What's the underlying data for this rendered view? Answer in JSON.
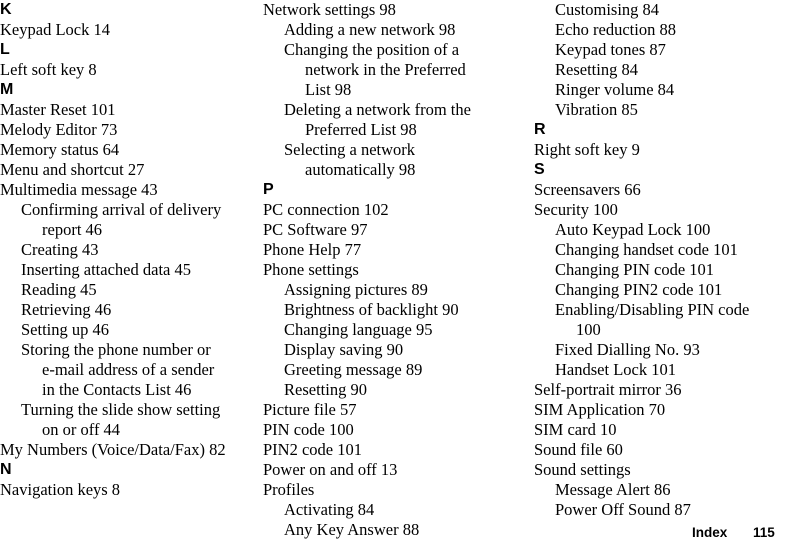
{
  "document": {
    "type": "printed-index-page",
    "footer": {
      "section_label": "Index",
      "page_number": "115"
    }
  },
  "columns": [
    {
      "id": "column-1",
      "blocks": [
        {
          "kind": "heading",
          "text": "K"
        },
        {
          "kind": "entry",
          "level": 0,
          "text": "Keypad Lock 14"
        },
        {
          "kind": "heading",
          "text": "L"
        },
        {
          "kind": "entry",
          "level": 0,
          "text": "Left soft key 8"
        },
        {
          "kind": "heading",
          "text": "M"
        },
        {
          "kind": "entry",
          "level": 0,
          "text": "Master Reset 101"
        },
        {
          "kind": "entry",
          "level": 0,
          "text": "Melody Editor 73"
        },
        {
          "kind": "entry",
          "level": 0,
          "text": "Memory status 64"
        },
        {
          "kind": "entry",
          "level": 0,
          "text": "Menu and shortcut 27"
        },
        {
          "kind": "entry",
          "level": 0,
          "text": "Multimedia message 43"
        },
        {
          "kind": "entry",
          "level": 1,
          "text": "Confirming arrival of delivery"
        },
        {
          "kind": "entry",
          "level": 2,
          "text": "report 46"
        },
        {
          "kind": "entry",
          "level": 1,
          "text": "Creating 43"
        },
        {
          "kind": "entry",
          "level": 1,
          "text": "Inserting attached data 45"
        },
        {
          "kind": "entry",
          "level": 1,
          "text": "Reading 45"
        },
        {
          "kind": "entry",
          "level": 1,
          "text": "Retrieving 46"
        },
        {
          "kind": "entry",
          "level": 1,
          "text": "Setting up 46"
        },
        {
          "kind": "entry",
          "level": 1,
          "text": "Storing the phone number or"
        },
        {
          "kind": "entry",
          "level": 2,
          "text": "e-mail address of a sender"
        },
        {
          "kind": "entry",
          "level": 2,
          "text": "in the Contacts List 46"
        },
        {
          "kind": "entry",
          "level": 1,
          "text": "Turning the slide show setting"
        },
        {
          "kind": "entry",
          "level": 2,
          "text": "on or off 44"
        },
        {
          "kind": "entry",
          "level": 0,
          "text": "My Numbers (Voice/Data/Fax) 82"
        },
        {
          "kind": "heading",
          "text": "N"
        },
        {
          "kind": "entry",
          "level": 0,
          "text": "Navigation keys 8"
        }
      ]
    },
    {
      "id": "column-2",
      "blocks": [
        {
          "kind": "entry",
          "level": 0,
          "text": "Network settings 98"
        },
        {
          "kind": "entry",
          "level": 1,
          "text": "Adding a new network 98"
        },
        {
          "kind": "entry",
          "level": 1,
          "text": "Changing the position of a"
        },
        {
          "kind": "entry",
          "level": 2,
          "text": "network in the Preferred"
        },
        {
          "kind": "entry",
          "level": 2,
          "text": "List 98"
        },
        {
          "kind": "entry",
          "level": 1,
          "text": "Deleting a network from the"
        },
        {
          "kind": "entry",
          "level": 2,
          "text": "Preferred List 98"
        },
        {
          "kind": "entry",
          "level": 1,
          "text": "Selecting a network"
        },
        {
          "kind": "entry",
          "level": 2,
          "text": "automatically 98"
        },
        {
          "kind": "heading",
          "text": "P"
        },
        {
          "kind": "entry",
          "level": 0,
          "text": "PC connection 102"
        },
        {
          "kind": "entry",
          "level": 0,
          "text": "PC Software 97"
        },
        {
          "kind": "entry",
          "level": 0,
          "text": "Phone Help 77"
        },
        {
          "kind": "entry",
          "level": 0,
          "text": "Phone settings"
        },
        {
          "kind": "entry",
          "level": 1,
          "text": "Assigning pictures 89"
        },
        {
          "kind": "entry",
          "level": 1,
          "text": "Brightness of backlight 90"
        },
        {
          "kind": "entry",
          "level": 1,
          "text": "Changing language 95"
        },
        {
          "kind": "entry",
          "level": 1,
          "text": "Display saving 90"
        },
        {
          "kind": "entry",
          "level": 1,
          "text": "Greeting message 89"
        },
        {
          "kind": "entry",
          "level": 1,
          "text": "Resetting 90"
        },
        {
          "kind": "entry",
          "level": 0,
          "text": "Picture file 57"
        },
        {
          "kind": "entry",
          "level": 0,
          "text": "PIN code 100"
        },
        {
          "kind": "entry",
          "level": 0,
          "text": "PIN2 code 101"
        },
        {
          "kind": "entry",
          "level": 0,
          "text": "Power on and off 13"
        },
        {
          "kind": "entry",
          "level": 0,
          "text": "Profiles"
        },
        {
          "kind": "entry",
          "level": 1,
          "text": "Activating 84"
        },
        {
          "kind": "entry",
          "level": 1,
          "text": "Any Key Answer 88"
        }
      ]
    },
    {
      "id": "column-3",
      "blocks": [
        {
          "kind": "entry",
          "level": 1,
          "text": "Customising 84"
        },
        {
          "kind": "entry",
          "level": 1,
          "text": "Echo reduction 88"
        },
        {
          "kind": "entry",
          "level": 1,
          "text": "Keypad tones 87"
        },
        {
          "kind": "entry",
          "level": 1,
          "text": "Resetting 84"
        },
        {
          "kind": "entry",
          "level": 1,
          "text": "Ringer volume 84"
        },
        {
          "kind": "entry",
          "level": 1,
          "text": "Vibration 85"
        },
        {
          "kind": "heading",
          "text": "R"
        },
        {
          "kind": "entry",
          "level": 0,
          "text": "Right soft key 9"
        },
        {
          "kind": "heading",
          "text": "S"
        },
        {
          "kind": "entry",
          "level": 0,
          "text": "Screensavers 66"
        },
        {
          "kind": "entry",
          "level": 0,
          "text": "Security 100"
        },
        {
          "kind": "entry",
          "level": 1,
          "text": "Auto Keypad Lock 100"
        },
        {
          "kind": "entry",
          "level": 1,
          "text": "Changing handset code 101"
        },
        {
          "kind": "entry",
          "level": 1,
          "text": "Changing PIN code 101"
        },
        {
          "kind": "entry",
          "level": 1,
          "text": "Changing PIN2 code 101"
        },
        {
          "kind": "entry",
          "level": 1,
          "text": "Enabling/Disabling PIN code"
        },
        {
          "kind": "entry",
          "level": 2,
          "text": "100"
        },
        {
          "kind": "entry",
          "level": 1,
          "text": "Fixed Dialling No. 93"
        },
        {
          "kind": "entry",
          "level": 1,
          "text": "Handset Lock 101"
        },
        {
          "kind": "entry",
          "level": 0,
          "text": "Self-portrait mirror 36"
        },
        {
          "kind": "entry",
          "level": 0,
          "text": "SIM Application 70"
        },
        {
          "kind": "entry",
          "level": 0,
          "text": "SIM card 10"
        },
        {
          "kind": "entry",
          "level": 0,
          "text": "Sound file 60"
        },
        {
          "kind": "entry",
          "level": 0,
          "text": "Sound settings"
        },
        {
          "kind": "entry",
          "level": 1,
          "text": "Message Alert 86"
        },
        {
          "kind": "entry",
          "level": 1,
          "text": "Power Off Sound 87"
        }
      ]
    }
  ]
}
